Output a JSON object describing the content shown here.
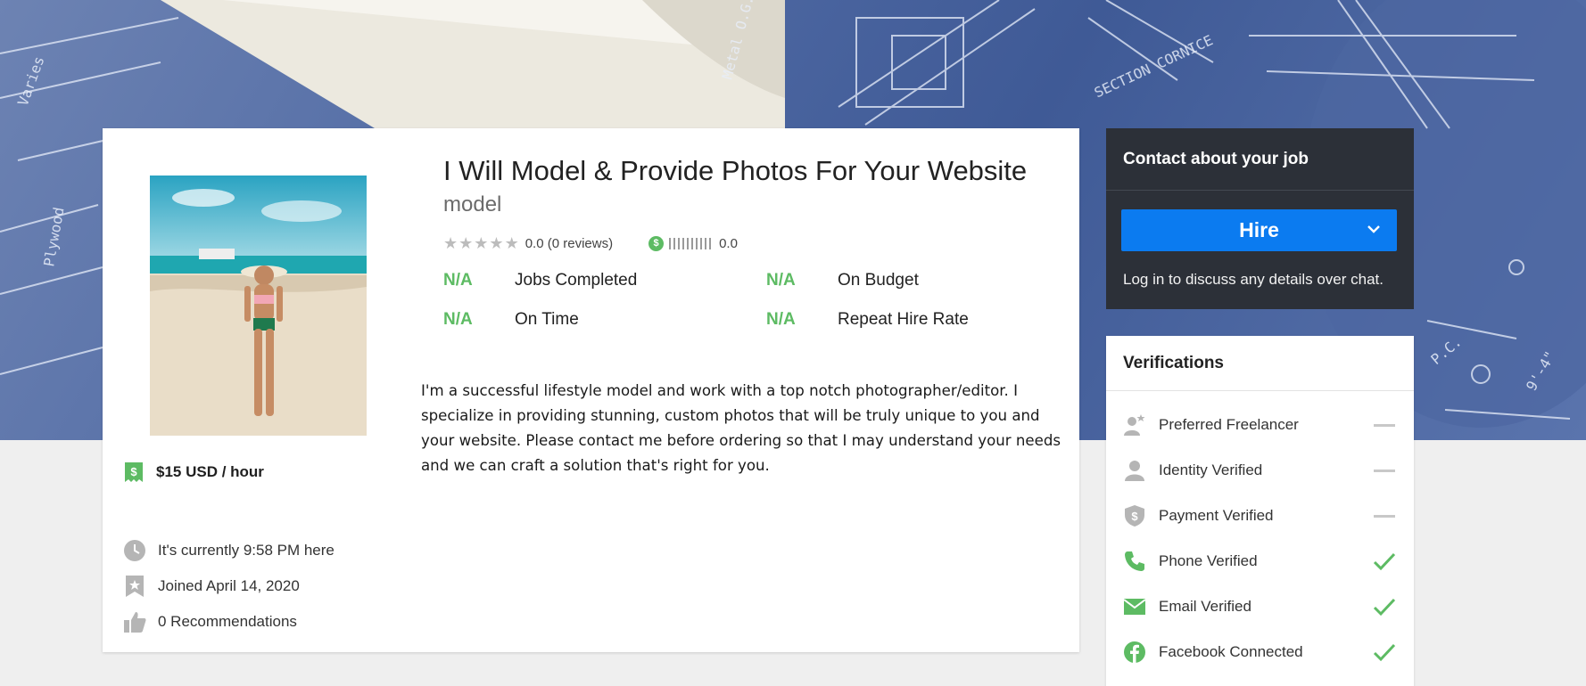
{
  "banner": {
    "description_hidden": ""
  },
  "profile": {
    "title": "I Will Model & Provide Photos For Your Website",
    "tagline": "model",
    "rating": "0.0 (0 reviews)",
    "earnings": "0.0",
    "rate": "$15 USD / hour",
    "stats": [
      {
        "value": "N/A",
        "label": "Jobs Completed"
      },
      {
        "value": "N/A",
        "label": "On Budget"
      },
      {
        "value": "N/A",
        "label": "On Time"
      },
      {
        "value": "N/A",
        "label": "Repeat Hire Rate"
      }
    ],
    "description": "I'm a successful lifestyle model and work with a top notch photographer/editor.  I specialize in providing stunning, custom photos that will be truly unique to you and your website. Please contact me before ordering so that I may understand your needs and we can craft a solution that's right for you.",
    "meta": {
      "local_time": "It's currently 9:58 PM here",
      "joined": "Joined April 14, 2020",
      "recommendations": "0 Recommendations"
    }
  },
  "contact": {
    "heading": "Contact  about your job",
    "hire_label": "Hire",
    "note": "Log in to discuss any details over chat."
  },
  "verifications": {
    "heading": "Verifications",
    "items": [
      {
        "label": "Preferred Freelancer",
        "verified": false
      },
      {
        "label": "Identity Verified",
        "verified": false
      },
      {
        "label": "Payment Verified",
        "verified": false
      },
      {
        "label": "Phone Verified",
        "verified": true
      },
      {
        "label": "Email Verified",
        "verified": true
      },
      {
        "label": "Facebook Connected",
        "verified": true
      }
    ]
  },
  "colors": {
    "accent_green": "#5dbb63",
    "hire_blue": "#0b7bf0",
    "panel_dark": "#2c3038"
  }
}
